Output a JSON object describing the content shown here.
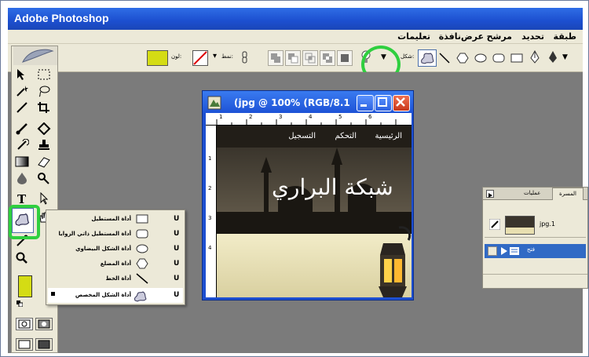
{
  "app_title": "Adobe Photoshop",
  "menu": [
    "طبقة",
    "تحديد",
    "مرشح",
    "عرض",
    "نافذة",
    "تعليمات"
  ],
  "options": {
    "color_label": "لون:",
    "style_label": "نمط:",
    "shape_label": "شكل:",
    "color_swatch": "#d4dc14"
  },
  "document": {
    "title": "(jpg @ 100% (RGB/8.1",
    "ruler_top": [
      "1",
      "2",
      "3",
      "4",
      "5",
      "6"
    ],
    "ruler_left": [
      "1",
      "2",
      "3",
      "4"
    ],
    "nav": [
      "الرئيسية",
      "التحكم",
      "التسجيل"
    ],
    "banner_text": "شبكة البراري"
  },
  "flyout": {
    "items": [
      {
        "label": "أداة المستطيل",
        "key": "U",
        "shape": "rect"
      },
      {
        "label": "أداة المستطيل ذاتي الزوايا",
        "key": "U",
        "shape": "rrect"
      },
      {
        "label": "أداة الشكل البيضاوي",
        "key": "U",
        "shape": "ellipse"
      },
      {
        "label": "أداة المضلع",
        "key": "U",
        "shape": "polygon"
      },
      {
        "label": "أداة الخط",
        "key": "U",
        "shape": "line"
      },
      {
        "label": "أداة الشكل المخصص",
        "key": "U",
        "shape": "custom",
        "selected": true
      }
    ]
  },
  "layers_panel": {
    "tabs": [
      "عمليات",
      "المسرة"
    ],
    "layer_name": "jpg.1",
    "row2_label": "فتح"
  },
  "colors": {
    "xp_blue": "#1d52d6",
    "xp_close": "#e0442a",
    "highlight_ring": "#2fcf3f",
    "foreground": "#d4dc14"
  }
}
